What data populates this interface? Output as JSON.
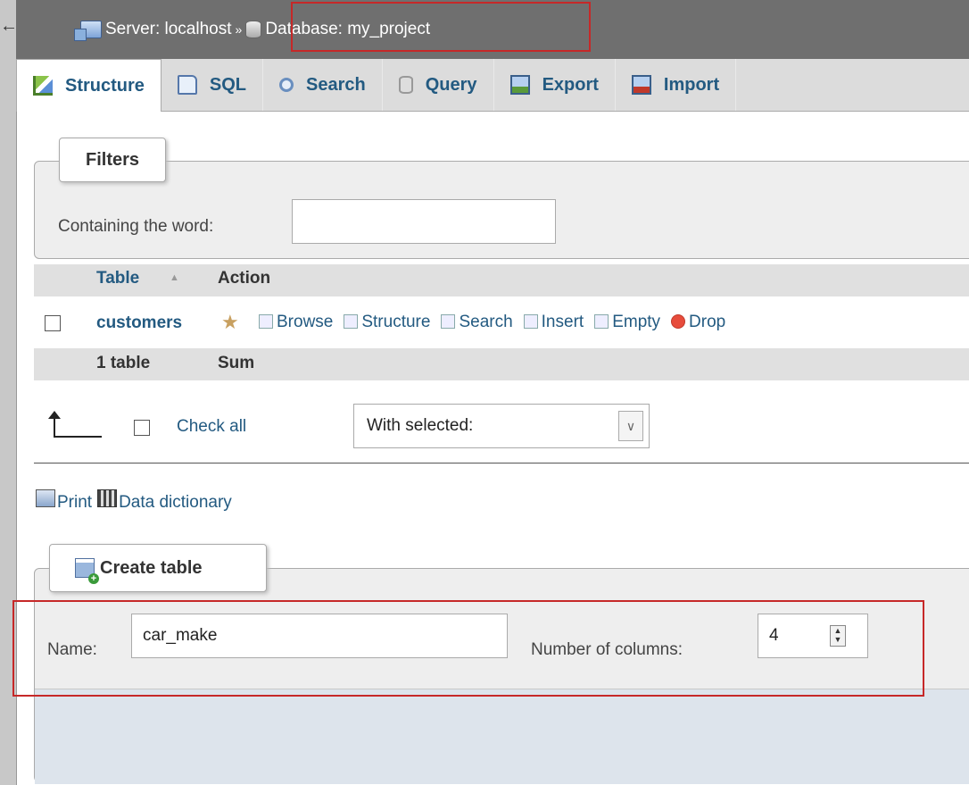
{
  "breadcrumb": {
    "back": "←",
    "server": "Server: localhost",
    "separator": "»",
    "database": "Database: my_project"
  },
  "tabs": [
    {
      "label": "Structure",
      "icon": "structure-icon",
      "active": true
    },
    {
      "label": "SQL",
      "icon": "sql-icon",
      "active": false
    },
    {
      "label": "Search",
      "icon": "search-icon",
      "active": false
    },
    {
      "label": "Query",
      "icon": "query-icon",
      "active": false
    },
    {
      "label": "Export",
      "icon": "export-icon",
      "active": false
    },
    {
      "label": "Import",
      "icon": "import-icon",
      "active": false
    }
  ],
  "filters": {
    "legend": "Filters",
    "containing_label": "Containing the word:",
    "containing_value": ""
  },
  "table_list": {
    "headers": {
      "table": "Table",
      "sort_indicator": "▲",
      "action": "Action"
    },
    "rows": [
      {
        "name": "customers",
        "actions": [
          "Browse",
          "Structure",
          "Search",
          "Insert",
          "Empty",
          "Drop"
        ]
      }
    ],
    "footer": {
      "count": "1 table",
      "sum": "Sum"
    }
  },
  "bulk": {
    "check_all": "Check all",
    "with_selected": "With selected:"
  },
  "links": {
    "print": "Print",
    "data_dictionary": "Data dictionary"
  },
  "create_table": {
    "legend": "Create table",
    "name_label": "Name:",
    "name_value": "car_make",
    "columns_label": "Number of columns:",
    "columns_value": "4"
  },
  "colors": {
    "link": "#235a81",
    "annotation": "#c62828",
    "header_bar": "#6f6f6f"
  }
}
